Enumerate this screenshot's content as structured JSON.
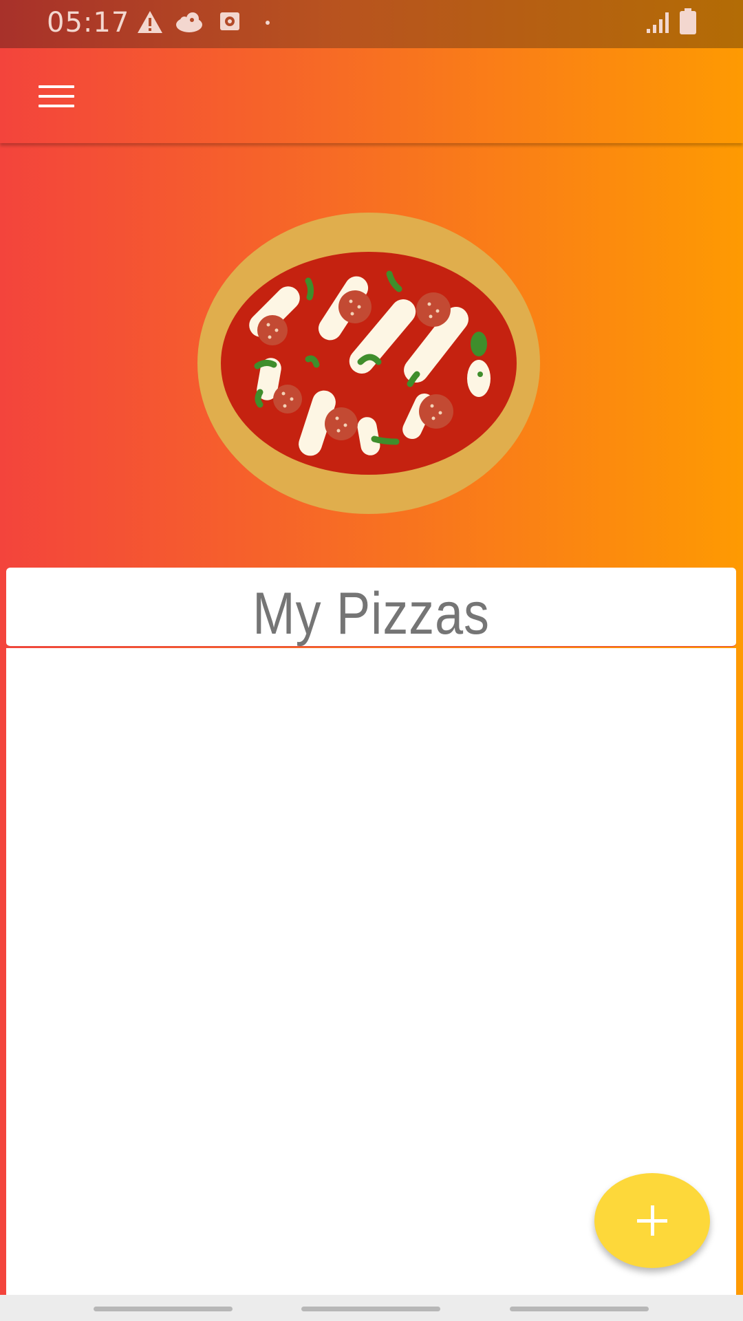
{
  "status_bar": {
    "time": "05:17",
    "icons": [
      "warning-icon",
      "cloud-face-icon",
      "media-icon",
      "dot-icon",
      "signal-icon",
      "battery-icon"
    ]
  },
  "app_bar": {
    "menu_icon": "hamburger-menu-icon"
  },
  "hero": {
    "image": "pizza-illustration"
  },
  "main": {
    "title": "My Pizzas",
    "items": []
  },
  "fab": {
    "icon": "plus-icon",
    "color": "#fdd83a"
  },
  "nav_bar": {
    "pills": 3
  },
  "colors": {
    "gradient_start": "#f3443c",
    "gradient_end": "#fe9a02",
    "title_text": "#757575"
  }
}
